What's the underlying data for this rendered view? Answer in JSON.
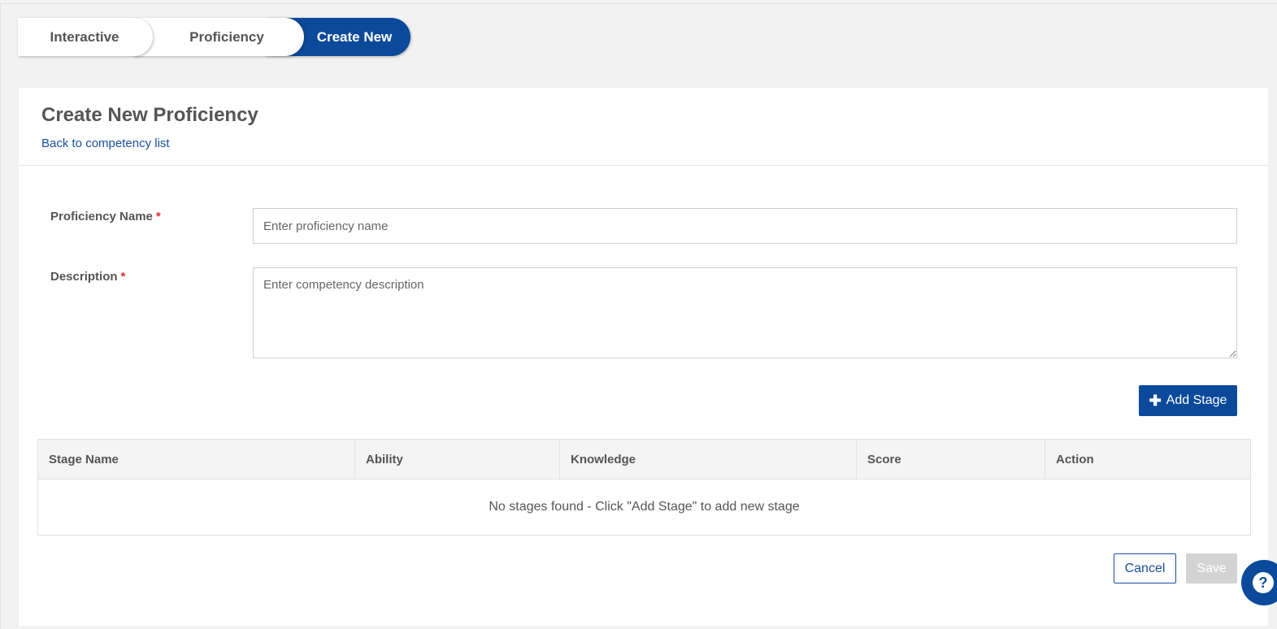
{
  "tabs": [
    {
      "label": "Interactive",
      "active": false
    },
    {
      "label": "Proficiency",
      "active": false
    },
    {
      "label": "Create New",
      "active": true
    }
  ],
  "header": {
    "title": "Create New Proficiency",
    "back_link": "Back to competency list"
  },
  "form": {
    "name_label": "Proficiency Name",
    "name_placeholder": "Enter proficiency name",
    "name_value": "",
    "description_label": "Description",
    "description_placeholder": "Enter competency description",
    "description_value": "",
    "required_marker": "*"
  },
  "add_stage": {
    "icon": "plus-icon",
    "icon_glyph": "✚",
    "label": "Add Stage"
  },
  "table": {
    "columns": [
      "Stage Name",
      "Ability",
      "Knowledge",
      "Score",
      "Action"
    ],
    "empty_message": "No stages found - Click \"Add Stage\" to add new stage"
  },
  "actions": {
    "cancel": "Cancel",
    "save": "Save",
    "save_enabled": false
  },
  "help": {
    "icon": "question-icon",
    "glyph": "?"
  },
  "colors": {
    "primary": "#0b4a9b",
    "link": "#1a4d9c",
    "required": "#d32f2f",
    "disabled": "#d3d3d3"
  }
}
